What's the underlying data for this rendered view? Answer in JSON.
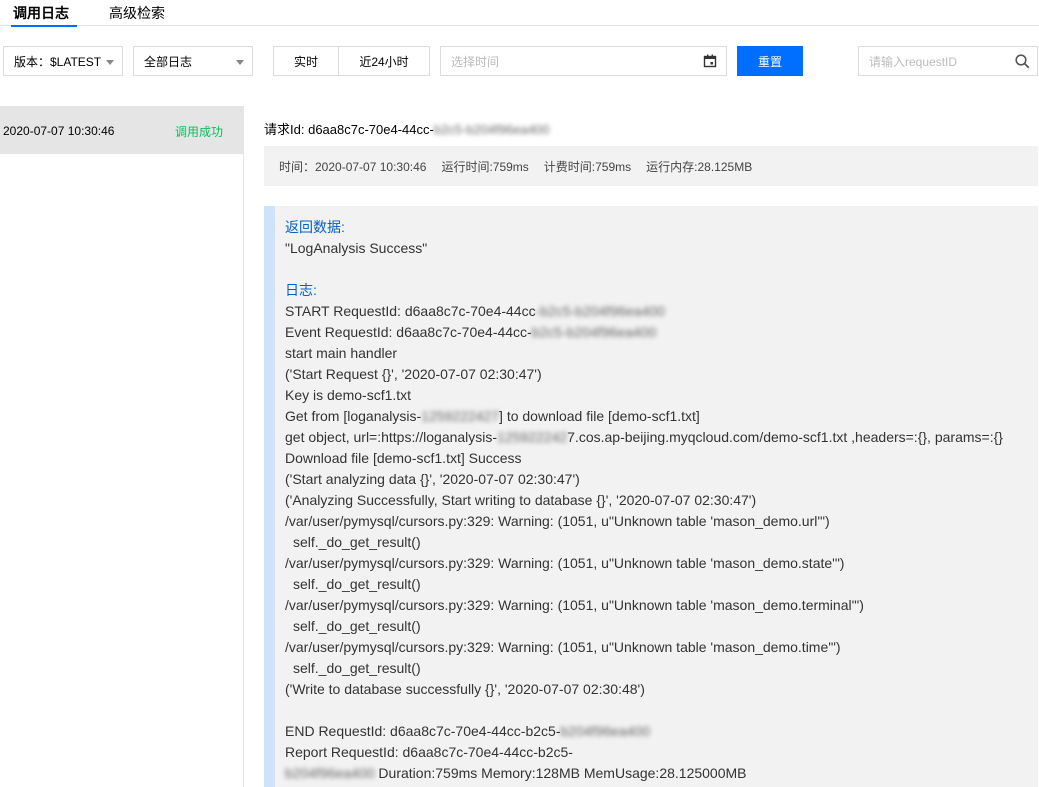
{
  "tabs": {
    "logs": "调用日志",
    "advanced": "高级检索"
  },
  "toolbar": {
    "version_label": "版本：$LATEST",
    "log_type_label": "全部日志",
    "realtime": "实时",
    "last24h": "近24小时",
    "time_placeholder": "选择时间",
    "reset": "重置",
    "search_placeholder": "请输入requestID"
  },
  "log_list": [
    {
      "time": "2020-07-07 10:30:46",
      "status": "调用成功",
      "status_color": "#0abf5b"
    }
  ],
  "detail": {
    "request_id_label": "请求Id:",
    "request_id_visible": "d6aa8c7c-70e4-44cc-",
    "request_id_blurred": "b2c5-b204f96ea400",
    "meta": {
      "time": "时间：2020-07-07 10:30:46",
      "run_time": "运行时间:759ms",
      "bill_time": "计费时间:759ms",
      "memory": "运行内存:28.125MB"
    },
    "return_label": "返回数据:",
    "return_value": "\"LogAnalysis Success\"",
    "log_label": "日志:",
    "log_lines": {
      "l1a": "START RequestId: d6aa8c7c-70e4-44cc",
      "l1b": "-b2c5-b204f96ea400",
      "l2a": "Event RequestId: d6aa8c7c-70e4-44cc-",
      "l2b": "b2c5-b204f96ea400",
      "l3": "start main handler",
      "l4": "('Start Request {}', '2020-07-07 02:30:47')",
      "l5": "Key is demo-scf1.txt",
      "l6a": "Get from [loganalysis-",
      "l6b": "1259222427",
      "l6c": "] to download file [demo-scf1.txt]",
      "l7a": "get object, url=:https://loganalysis-",
      "l7b": "125922242",
      "l7c": "7.cos.ap-beijing.myqcloud.com/demo-scf1.txt ,headers=:{}, params=:{}",
      "l8": "Download file [demo-scf1.txt] Success",
      "l9": "('Start analyzing data {}', '2020-07-07 02:30:47')",
      "l10": "('Analyzing Successfully, Start writing to database {}', '2020-07-07 02:30:47')",
      "l11": "/var/user/pymysql/cursors.py:329: Warning: (1051, u\"Unknown table 'mason_demo.url'\")",
      "l12": "self._do_get_result()",
      "l13": "/var/user/pymysql/cursors.py:329: Warning: (1051, u\"Unknown table 'mason_demo.state'\")",
      "l14": "self._do_get_result()",
      "l15": "/var/user/pymysql/cursors.py:329: Warning: (1051, u\"Unknown table 'mason_demo.terminal'\")",
      "l16": "self._do_get_result()",
      "l17": "/var/user/pymysql/cursors.py:329: Warning: (1051, u\"Unknown table 'mason_demo.time'\")",
      "l18": "self._do_get_result()",
      "l19": "('Write to database successfully {}', '2020-07-07 02:30:48')",
      "l20a": "END RequestId: d6aa8c7c-70e4-44cc-b2c5-",
      "l20b": "b204f96ea400",
      "l21": "Report RequestId: d6aa8c7c-70e4-44cc-b2c5-",
      "l22a": "b204f96ea400",
      "l22b": " Duration:759ms Memory:128MB MemUsage:28.125000MB"
    }
  },
  "colors": {
    "primary": "#006eff",
    "success": "#0abf5b",
    "label_blue": "#0061c8",
    "panel_bg": "#f2f2f2",
    "quote_bar": "#cfe3f8"
  }
}
